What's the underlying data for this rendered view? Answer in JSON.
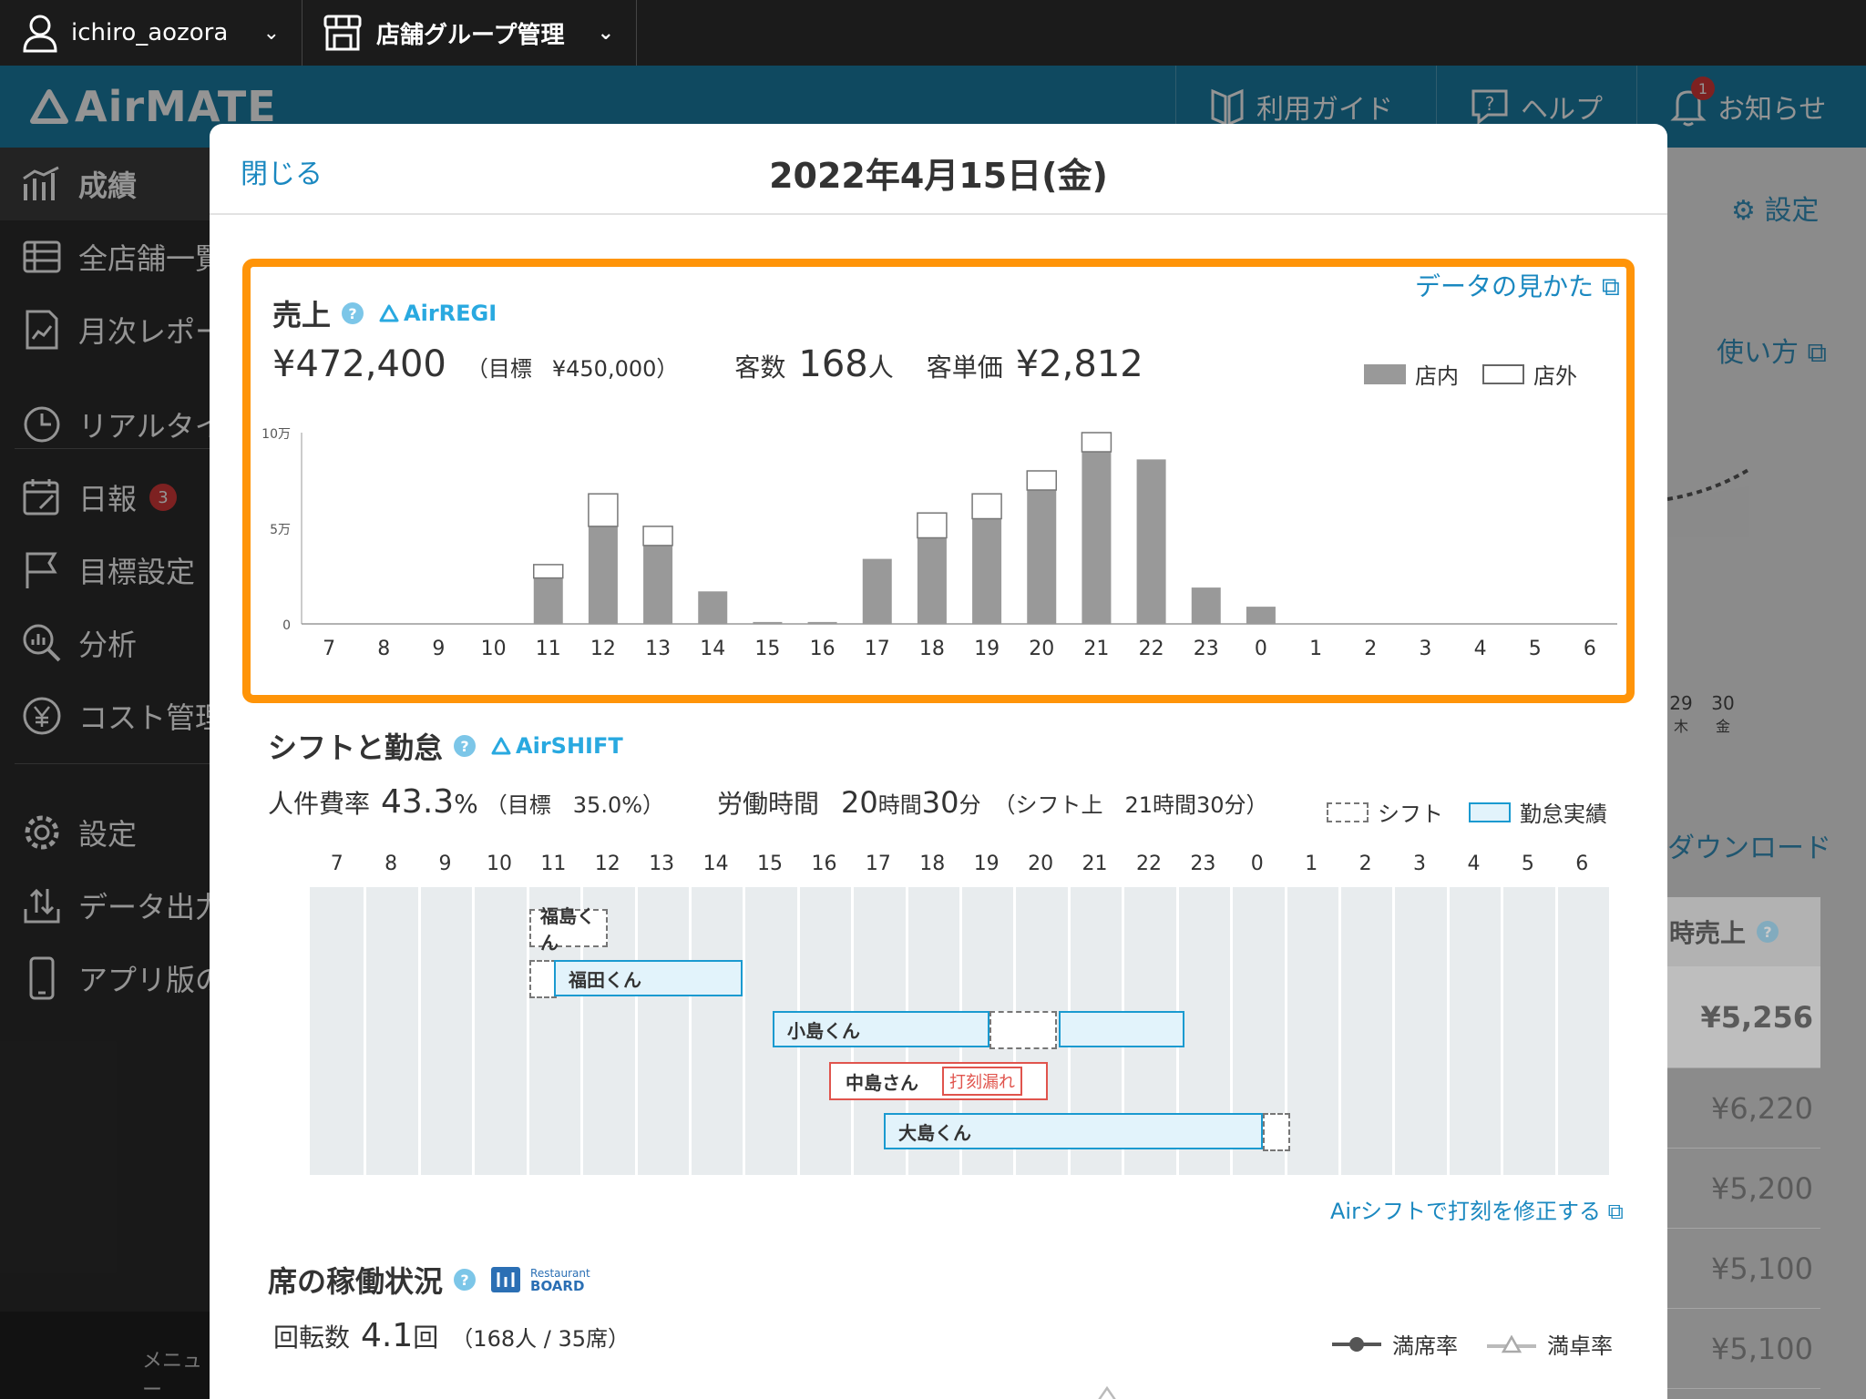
{
  "topbar": {
    "user": "ichiro_aozora",
    "group": "店舗グループ管理"
  },
  "header": {
    "logo": "AirMATE",
    "guide": "利用ガイド",
    "help": "ヘルプ",
    "notice": "お知らせ",
    "notice_count": "1"
  },
  "sidebar": {
    "items": [
      {
        "label": "成績"
      },
      {
        "label": "全店舗一覧"
      },
      {
        "label": "月次レポート"
      },
      {
        "label": "リアルタイム"
      },
      {
        "label": "日報",
        "badge": "3"
      },
      {
        "label": "目標設定"
      },
      {
        "label": "分析"
      },
      {
        "label": "コスト管理"
      },
      {
        "label": "設定"
      },
      {
        "label": "データ出力"
      },
      {
        "label": "アプリ版の"
      }
    ],
    "footer": "メニュー"
  },
  "background": {
    "settings": "設定",
    "howto": "使い方",
    "download": "ダウンロード",
    "dates": [
      {
        "d": "29",
        "w": "木"
      },
      {
        "d": "30",
        "w": "金"
      }
    ],
    "table_header": "時売上",
    "table_values": [
      "¥5,256",
      "¥6,220",
      "¥5,200",
      "¥5,100",
      "¥5,100"
    ]
  },
  "modal": {
    "close": "閉じる",
    "title": "2022年4月15日(金)"
  },
  "sales": {
    "title": "売上",
    "brand": "AirREGI",
    "data_howto": "データの見かた",
    "amount": "¥472,400",
    "target_label": "（目標",
    "target_value": "¥450,000）",
    "customers_label": "客数",
    "customers_value": "168",
    "customers_unit": "人",
    "unit_price_label": "客単価",
    "unit_price_value": "¥2,812",
    "legend_in": "店内",
    "legend_out": "店外"
  },
  "chart_data": {
    "type": "bar",
    "stacked": true,
    "categories": [
      "7",
      "8",
      "9",
      "10",
      "11",
      "12",
      "13",
      "14",
      "15",
      "16",
      "17",
      "18",
      "19",
      "20",
      "21",
      "22",
      "23",
      "0",
      "1",
      "2",
      "3",
      "4",
      "5",
      "6"
    ],
    "y_tick_labels": [
      "0",
      "5万",
      "10万"
    ],
    "ylim": [
      0,
      100000
    ],
    "series": [
      {
        "name": "店内",
        "color": "#999999",
        "values": [
          0,
          0,
          0,
          0,
          24000,
          51000,
          41000,
          17000,
          1000,
          1000,
          34000,
          45000,
          55000,
          70000,
          90000,
          86000,
          19000,
          9000,
          0,
          0,
          0,
          0,
          0,
          0
        ]
      },
      {
        "name": "店外",
        "color": "#ffffff",
        "values": [
          0,
          0,
          0,
          0,
          7000,
          17000,
          10000,
          0,
          0,
          0,
          0,
          13000,
          13000,
          10000,
          10000,
          0,
          0,
          0,
          0,
          0,
          0,
          0,
          0,
          0
        ]
      }
    ]
  },
  "shift": {
    "title": "シフトと勤怠",
    "brand": "AirSHIFT",
    "labor_label": "人件費率",
    "labor_value": "43.3",
    "labor_unit": "%",
    "labor_target": "（目標　35.0%）",
    "hours_label": "労働時間",
    "hours_value_h": "20",
    "hours_unit_h": "時間",
    "hours_value_m": "30",
    "hours_unit_m": "分",
    "hours_shift": "（シフト上　21時間30分）",
    "legend_shift": "シフト",
    "legend_actual": "勤怠実績",
    "hours": [
      "7",
      "8",
      "9",
      "10",
      "11",
      "12",
      "13",
      "14",
      "15",
      "16",
      "17",
      "18",
      "19",
      "20",
      "21",
      "22",
      "23",
      "0",
      "1",
      "2",
      "3",
      "4",
      "5",
      "6"
    ],
    "staff": [
      "福島くん",
      "福田くん",
      "小島くん",
      "中島さん",
      "大島くん"
    ],
    "missing_tag": "打刻漏れ",
    "fix_link": "Airシフトで打刻を修正する"
  },
  "seats": {
    "title": "席の稼働状況",
    "brand_top": "Restaurant",
    "brand_bottom": "BOARD",
    "turnover_label": "回転数",
    "turnover_value": "4.1",
    "turnover_unit": "回",
    "turnover_detail": "（168人 / 35席）",
    "legend_full_seat": "満席率",
    "legend_full_table": "満卓率"
  }
}
